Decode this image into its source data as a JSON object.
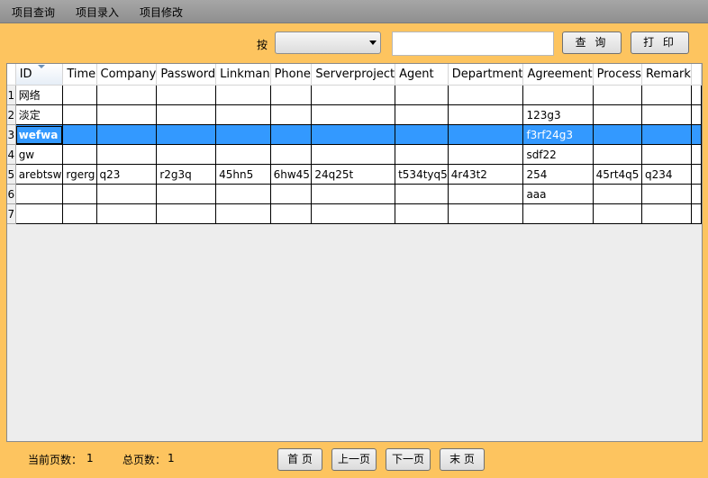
{
  "menu": {
    "items": [
      "项目查询",
      "项目录入",
      "项目修改"
    ]
  },
  "search": {
    "label": "按",
    "combo_value": "",
    "input_value": "",
    "query_button": "查 询",
    "print_button": "打 印"
  },
  "grid": {
    "columns": [
      "ID",
      "Time",
      "Company",
      "Password",
      "Linkman",
      "Phone",
      "Serverproject",
      "Agent",
      "Department",
      "Agreement",
      "Process",
      "Remark"
    ],
    "rows": [
      {
        "num": "1",
        "cells": [
          "网络",
          "",
          "",
          "",
          "",
          "",
          "",
          "",
          "",
          "",
          "",
          ""
        ]
      },
      {
        "num": "2",
        "cells": [
          "淡定",
          "",
          "",
          "",
          "",
          "",
          "",
          "",
          "",
          "123g3",
          "",
          ""
        ]
      },
      {
        "num": "3",
        "cells": [
          "wefwa",
          "",
          "",
          "",
          "",
          "",
          "",
          "",
          "",
          "f3rf24g3",
          "",
          ""
        ]
      },
      {
        "num": "4",
        "cells": [
          "gw",
          "",
          "",
          "",
          "",
          "",
          "",
          "",
          "",
          "sdf22",
          "",
          ""
        ]
      },
      {
        "num": "5",
        "cells": [
          "arebtsw",
          "rgerg",
          "q23",
          "r2g3q",
          "45hn5",
          "6hw45",
          "24q25t",
          "t534tyq5",
          "4r43t2",
          "254",
          "45rt4q5",
          "q234"
        ]
      },
      {
        "num": "6",
        "cells": [
          "",
          "",
          "",
          "",
          "",
          "",
          "",
          "",
          "",
          "aaa",
          "",
          ""
        ]
      },
      {
        "num": "7",
        "cells": [
          "",
          "",
          "",
          "",
          "",
          "",
          "",
          "",
          "",
          "",
          "",
          ""
        ]
      }
    ],
    "selected_row": "3"
  },
  "footer": {
    "current_page_label": "当前页数：",
    "current_page": "1",
    "total_pages_label": "总页数：",
    "total_pages": "1",
    "first_page": "首 页",
    "prev_page": "上一页",
    "next_page": "下一页",
    "last_page": "末 页"
  }
}
